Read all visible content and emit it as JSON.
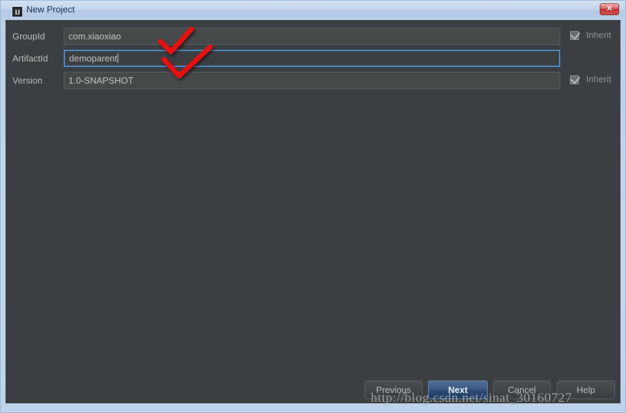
{
  "window": {
    "title": "New Project",
    "icon": "intellij-idea-icon",
    "close_label": "✕",
    "frame_color": "#bed2ea",
    "dialog_bg": "#3c3f41"
  },
  "form": {
    "rows": [
      {
        "label": "GroupId",
        "value": "com.xiaoxiao",
        "placeholder": "",
        "focused": false,
        "inherit": {
          "label": "Inherit",
          "checked": true,
          "disabled": true
        }
      },
      {
        "label": "ArtifactId",
        "value": "demoparent",
        "placeholder": "",
        "focused": true,
        "inherit": null
      },
      {
        "label": "Version",
        "value": "1.0-SNAPSHOT",
        "placeholder": "",
        "focused": false,
        "inherit": {
          "label": "Inherit",
          "checked": true,
          "disabled": true
        }
      }
    ]
  },
  "buttons": {
    "previous": "Previous",
    "next": "Next",
    "cancel": "Cancel",
    "help": "Help",
    "default_button": "Next",
    "accent_color": "#3c5a84"
  },
  "annotations": {
    "marks": [
      {
        "name": "red-checkmark-artifactid-upper",
        "color": "#ee1111"
      },
      {
        "name": "red-checkmark-artifactid-lower",
        "color": "#ee1111"
      }
    ]
  },
  "watermark": {
    "text": "http://blog.csdn.net/sinat_30160727"
  }
}
